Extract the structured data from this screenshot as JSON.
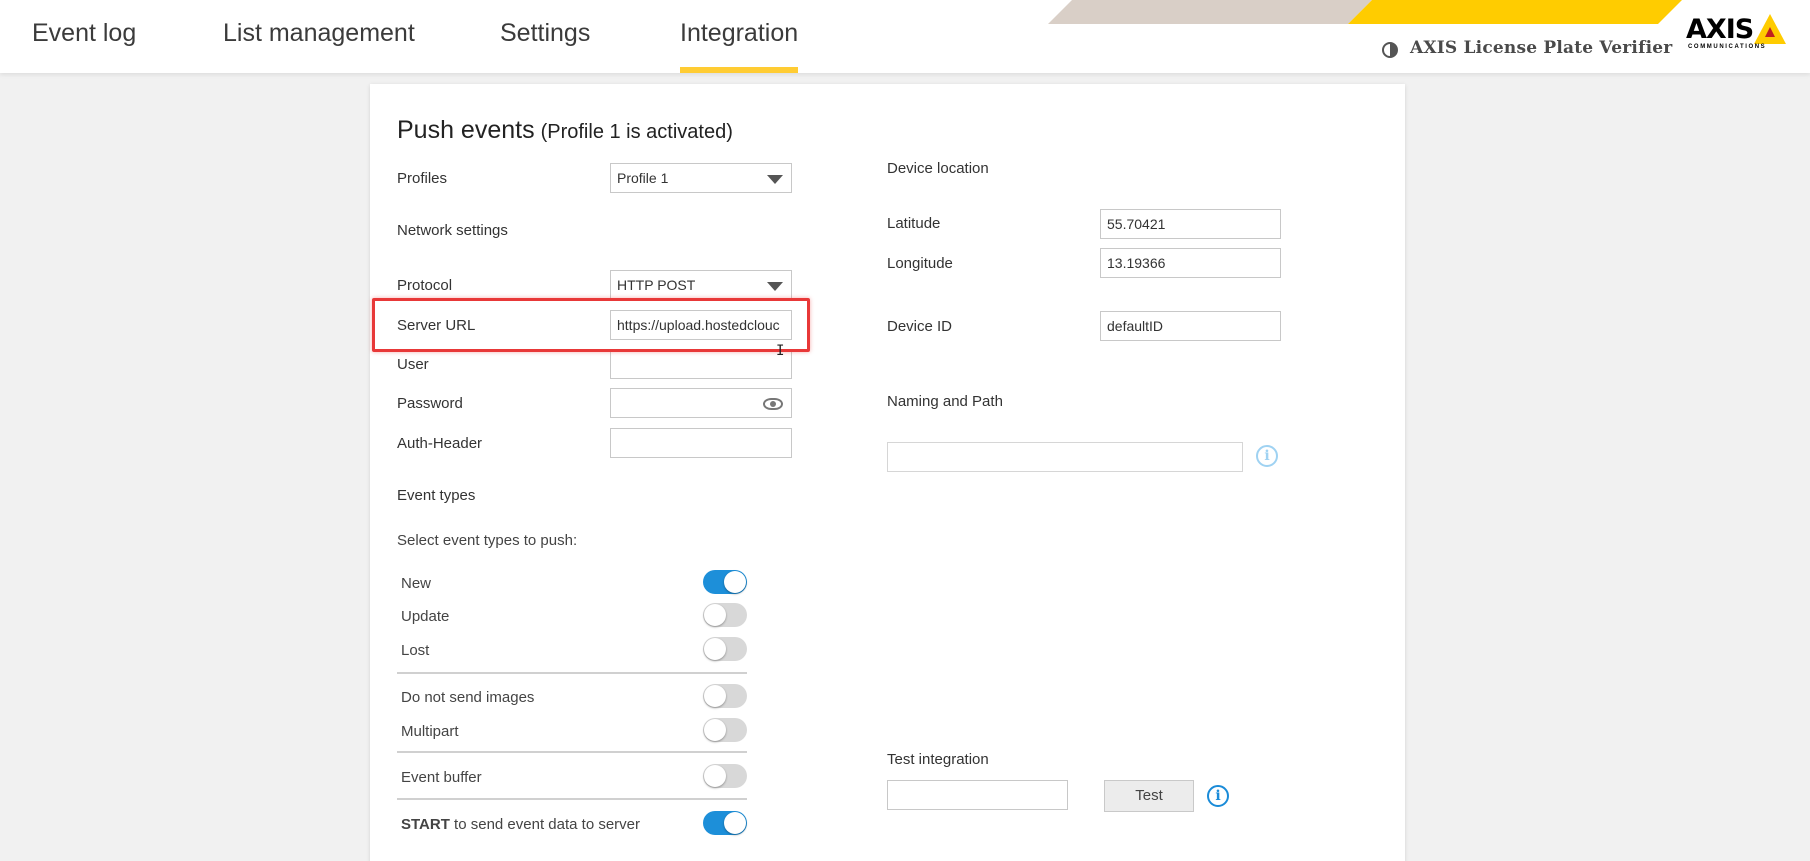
{
  "nav": {
    "tabs": [
      {
        "label": "Event log"
      },
      {
        "label": "List management"
      },
      {
        "label": "Settings"
      },
      {
        "label": "Integration",
        "active": true
      }
    ]
  },
  "brand": {
    "product": "AXIS License Plate Verifier",
    "logo_text": "AXIS",
    "logo_sub": "COMMUNICATIONS",
    "accent_color": "#ffcc33"
  },
  "push_events": {
    "title": "Push events",
    "status": "(Profile 1 is activated)",
    "profiles_label": "Profiles",
    "profile_selected": "Profile 1",
    "network_settings_label": "Network settings",
    "protocol_label": "Protocol",
    "protocol_selected": "HTTP POST",
    "server_url_label": "Server URL",
    "server_url_value": "https://upload.hostedclouc",
    "user_label": "User",
    "user_value": "",
    "password_label": "Password",
    "password_value": "",
    "auth_header_label": "Auth-Header",
    "auth_header_value": ""
  },
  "event_types": {
    "title": "Event types",
    "hint": "Select event types to push:",
    "toggles": [
      {
        "label": "New",
        "on": true
      },
      {
        "label": "Update",
        "on": false
      },
      {
        "label": "Lost",
        "on": false
      },
      {
        "label": "Do not send images",
        "on": false
      },
      {
        "label": "Multipart",
        "on": false
      },
      {
        "label": "Event buffer",
        "on": false
      }
    ],
    "start_strong": "START",
    "start_rest": " to send event data to server",
    "start_on": true
  },
  "device": {
    "location_label": "Device location",
    "latitude_label": "Latitude",
    "latitude_value": "55.70421",
    "longitude_label": "Longitude",
    "longitude_value": "13.19366",
    "device_id_label": "Device ID",
    "device_id_value": "defaultID",
    "naming_label": "Naming and Path",
    "naming_value": ""
  },
  "test": {
    "label": "Test integration",
    "input_value": "",
    "button_label": "Test"
  },
  "icons": {
    "info": "i"
  }
}
